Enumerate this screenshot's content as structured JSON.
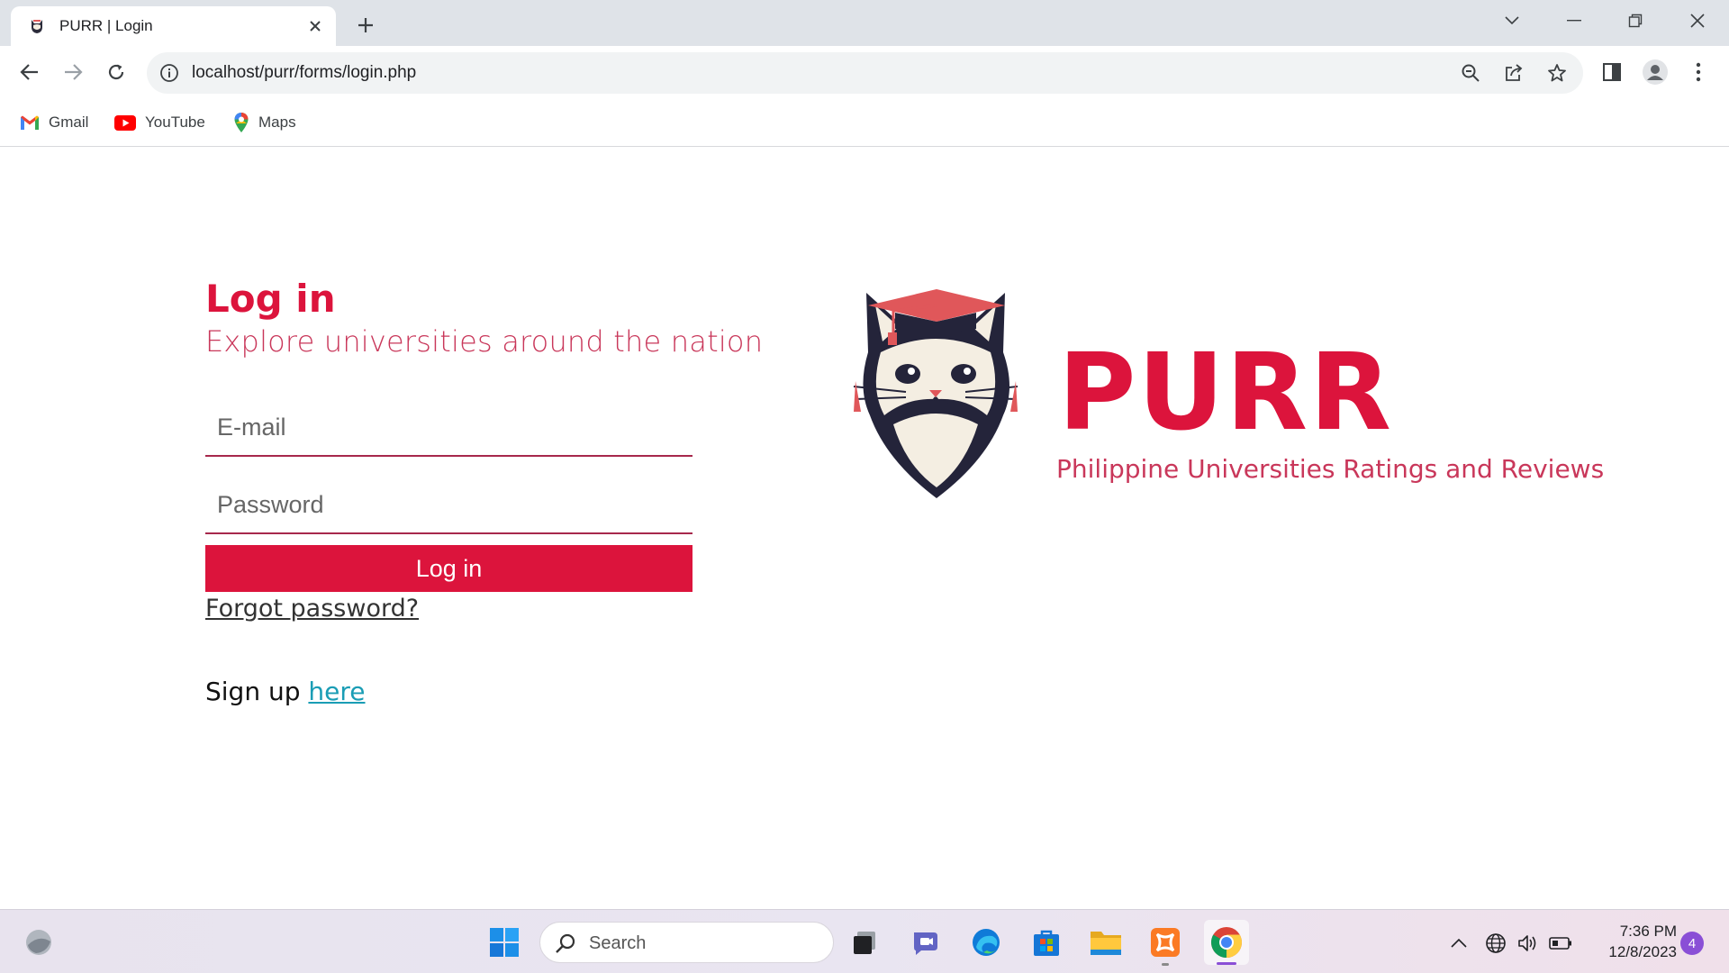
{
  "browser": {
    "tab": {
      "title": "PURR | Login"
    },
    "address": {
      "url": "localhost/purr/forms/login.php"
    },
    "bookmarks": [
      {
        "label": "Gmail",
        "icon": "gmail-icon"
      },
      {
        "label": "YouTube",
        "icon": "youtube-icon"
      },
      {
        "label": "Maps",
        "icon": "maps-icon"
      }
    ]
  },
  "login": {
    "title": "Log in",
    "subtitle": "Explore universities around the nation",
    "email_placeholder": "E-mail",
    "password_placeholder": "Password",
    "submit_label": "Log in",
    "forgot_label": "Forgot password?",
    "signup_prefix": "Sign up",
    "signup_link": "here"
  },
  "brand": {
    "name": "PURR",
    "tagline": "Philippine Universities Ratings and Reviews"
  },
  "taskbar": {
    "search_label": "Search",
    "time": "7:36 PM",
    "date": "12/8/2023",
    "notification_count": "4"
  },
  "colors": {
    "accent": "#dc143c",
    "subtitle": "#c9375a",
    "link": "#1a9db5"
  }
}
